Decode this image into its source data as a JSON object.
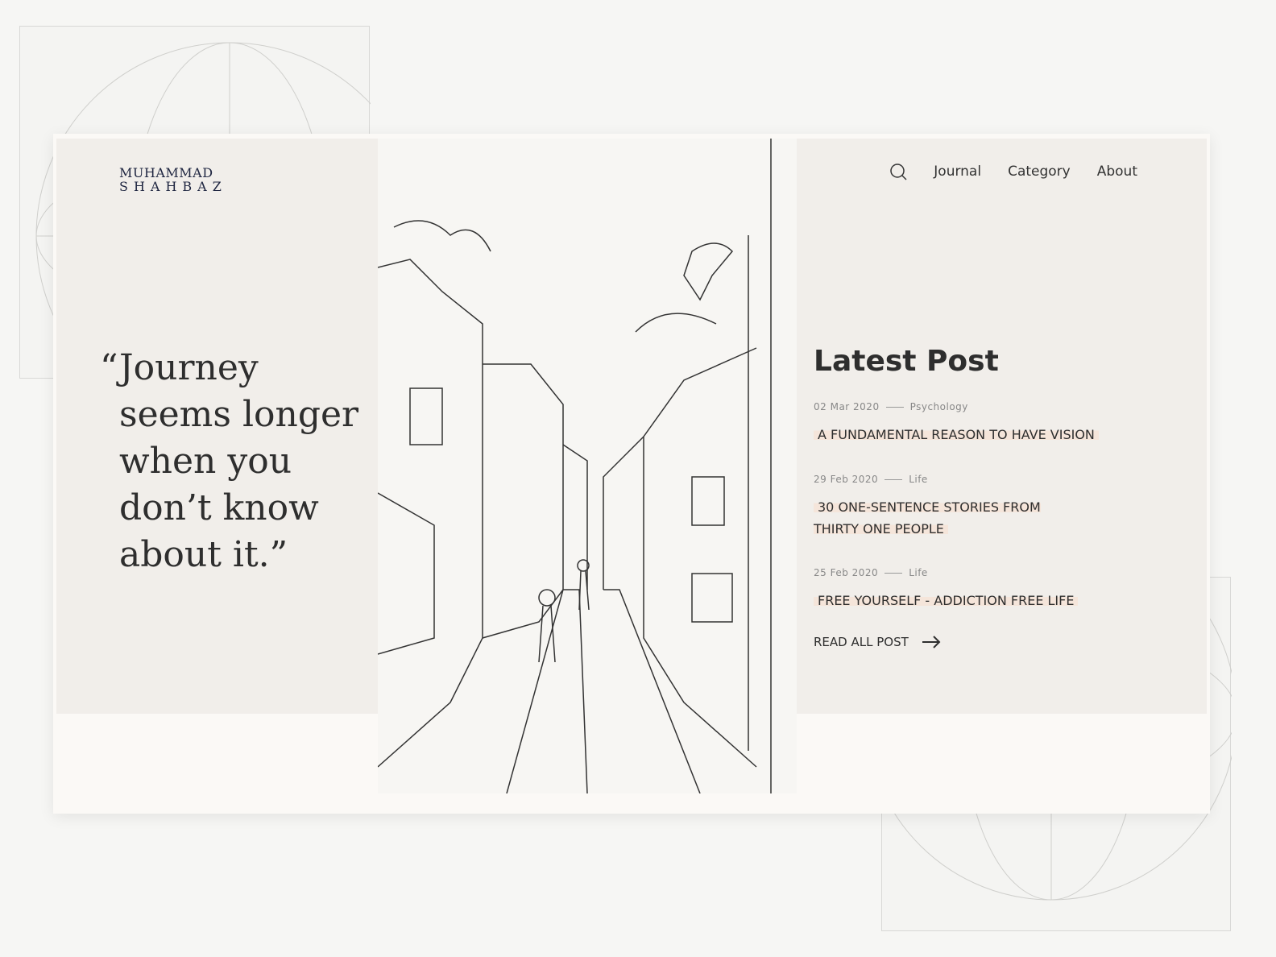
{
  "logo": {
    "line1": "MUHAMMAD",
    "line2": "SHAHBAZ"
  },
  "nav": {
    "items": [
      "Journal",
      "Category",
      "About"
    ],
    "search_icon": "search-icon"
  },
  "quote": {
    "open": "“",
    "text": "Journey seems longer when you don’t know about it.”"
  },
  "latest": {
    "heading": "Latest Post",
    "posts": [
      {
        "date": "02 Mar 2020",
        "category": "Psychology",
        "title": "A FUNDAMENTAL REASON TO HAVE VISION"
      },
      {
        "date": "29 Feb 2020",
        "category": "Life",
        "title": "30 ONE-SENTENCE STORIES FROM THIRTY ONE PEOPLE"
      },
      {
        "date": "25 Feb 2020",
        "category": "Life",
        "title": "FREE YOURSELF - ADDICTION FREE LIFE"
      }
    ],
    "read_all": "READ ALL POST"
  },
  "colors": {
    "accent": "#f5e5da",
    "text": "#2e2e2e",
    "logo": "#1e2540"
  }
}
